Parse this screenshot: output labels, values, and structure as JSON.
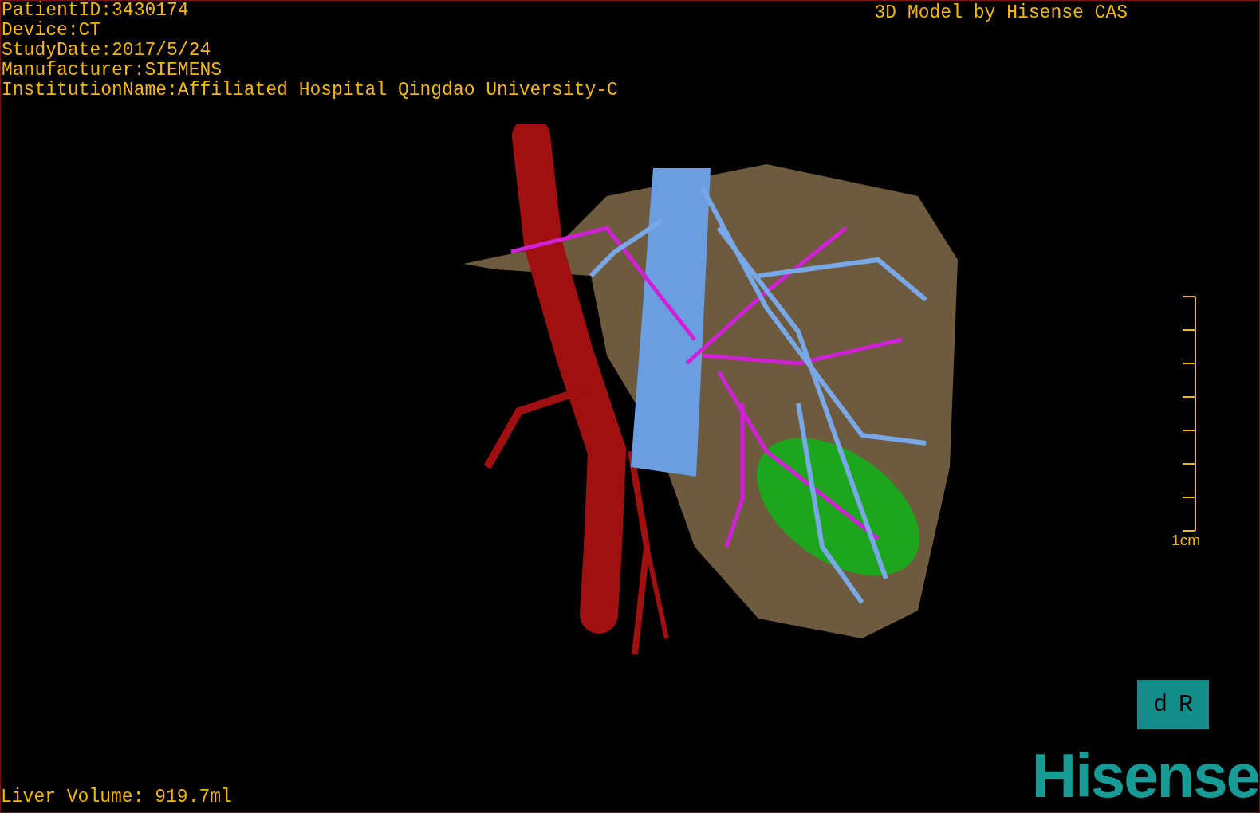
{
  "patient_info": [
    "PatientID:3430174",
    "Device:CT",
    "StudyDate:2017/5/24",
    "Manufacturer:SIEMENS",
    "InstitutionName:Affiliated Hospital Qingdao University-C"
  ],
  "model_credit": "3D Model by Hisense CAS",
  "scale_bar": {
    "label": "1cm"
  },
  "orientation_cube": {
    "labels": [
      "d",
      "R"
    ]
  },
  "logo": "Hisense",
  "liver_volume": "Liver Volume: 919.7ml"
}
